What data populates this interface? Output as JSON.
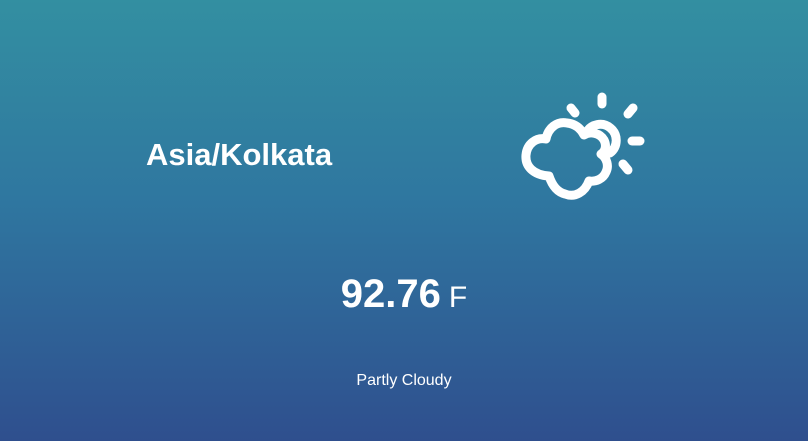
{
  "weather": {
    "timezone": "Asia/Kolkata",
    "icon": "partly-cloudy-day-icon",
    "temperature_value": "92.76",
    "temperature_unit": "F",
    "summary": "Partly Cloudy"
  },
  "colors": {
    "gradient_top": "#338fa1",
    "gradient_bottom": "#2f4f8e",
    "text": "#ffffff"
  }
}
